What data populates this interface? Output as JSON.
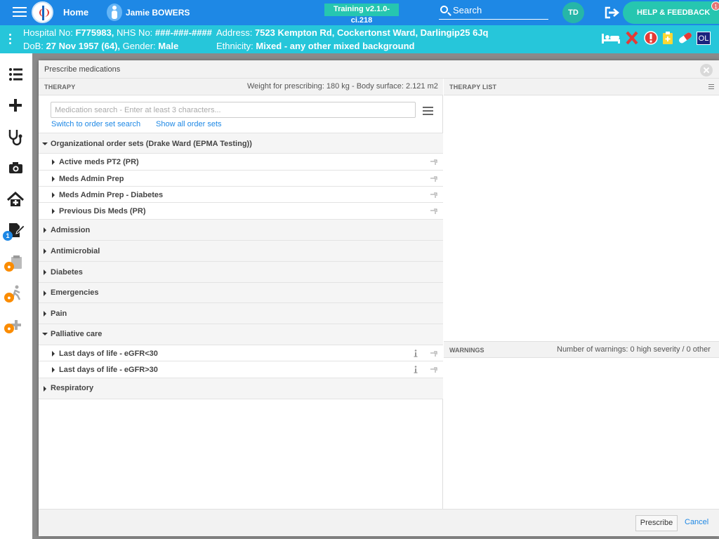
{
  "topbar": {
    "home": "Home",
    "patient_name": "Jamie BOWERS",
    "training": "Training v2.1.0-ci.218",
    "search": "Search",
    "avatar": "TD",
    "help": "HELP & FEEDBACK",
    "help_badge": "1"
  },
  "banner": {
    "hospital_label": "Hospital No:",
    "hospital_no": "F775983,",
    "nhs_label": "NHS No:",
    "nhs_no": "###-###-####",
    "address_label": "Address:",
    "address": "7523 Kempton Rd, Cockertonst Ward, Darlingip25 6Jq",
    "dob_label": "DoB:",
    "dob": "27 Nov 1957 (64),",
    "gender_label": "Gender:",
    "gender": "Male",
    "ethnicity_label": "Ethnicity:",
    "ethnicity": "Mixed - any other mixed background",
    "icon_ol": "OL"
  },
  "nav": {
    "badge_count": "1"
  },
  "modal": {
    "title": "Prescribe medications",
    "therapy": {
      "header": "THERAPY",
      "weight_info": "Weight for prescribing: 180 kg - Body surface: 2.121 m2",
      "search_placeholder": "Medication search - Enter at least 3 characters...",
      "link_order_set": "Switch to order set search",
      "link_show_all": "Show all order sets"
    },
    "tree": {
      "org_group": "Organizational order sets (Drake Ward (EPMA Testing))",
      "org_items": [
        "Active meds PT2 (PR)",
        "Meds Admin Prep",
        "Meds Admin Prep - Diabetes",
        "Previous Dis Meds (PR)"
      ],
      "groups": [
        "Admission",
        "Antimicrobial",
        "Diabetes",
        "Emergencies",
        "Pain"
      ],
      "palliative": "Palliative care",
      "palliative_items": [
        "Last days of life - eGFR<30",
        "Last days of life - eGFR>30"
      ],
      "respiratory": "Respiratory"
    },
    "therapy_list": {
      "header": "THERAPY LIST"
    },
    "warnings": {
      "header": "WARNINGS",
      "count_text": "Number of warnings: 0 high severity / 0 other"
    },
    "footer": {
      "prescribe": "Prescribe",
      "cancel": "Cancel"
    }
  },
  "colors": {
    "topbar": "#1e88e5",
    "banner": "#26c6da",
    "accent": "#26c6b0"
  }
}
